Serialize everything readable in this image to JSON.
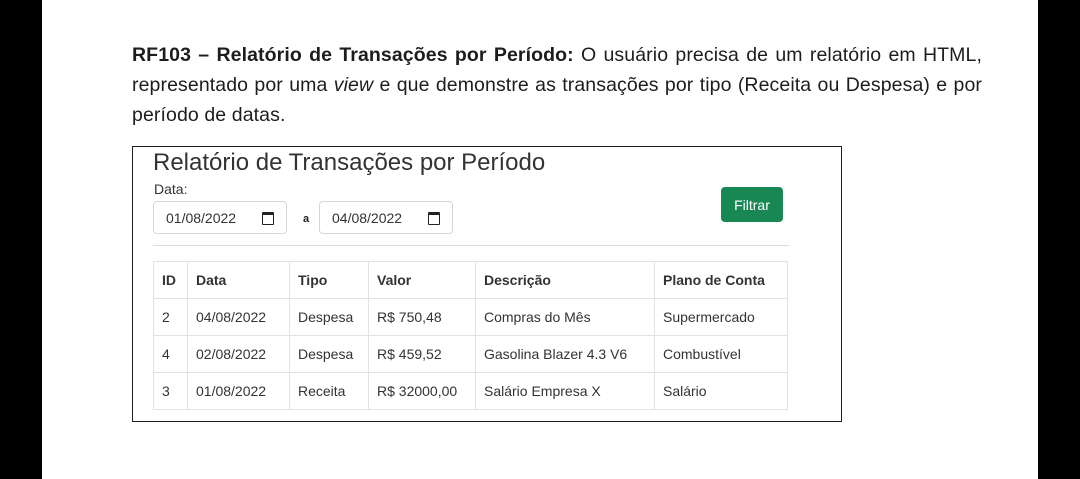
{
  "requirement": {
    "code_title": "RF103 – Relatório de Transações por Período:",
    "text_1": " O usuário precisa de um relatório em HTML, representado por uma ",
    "text_italic": "view",
    "text_2": " e que demonstre as transações por tipo (Receita ou Despesa) e por período de datas."
  },
  "report": {
    "title": "Relatório de Transações por Período",
    "date_label": "Data:",
    "start_date": "01/08/2022",
    "separator": "a",
    "end_date": "04/08/2022",
    "filter_button": "Filtrar",
    "button_color": "#198754"
  },
  "table": {
    "headers": [
      "ID",
      "Data",
      "Tipo",
      "Valor",
      "Descrição",
      "Plano de Conta"
    ],
    "rows": [
      [
        "2",
        "04/08/2022",
        "Despesa",
        "R$ 750,48",
        "Compras do Mês",
        "Supermercado"
      ],
      [
        "4",
        "02/08/2022",
        "Despesa",
        "R$ 459,52",
        "Gasolina Blazer 4.3 V6",
        "Combustível"
      ],
      [
        "3",
        "01/08/2022",
        "Receita",
        "R$ 32000,00",
        "Salário Empresa X",
        "Salário"
      ]
    ]
  }
}
